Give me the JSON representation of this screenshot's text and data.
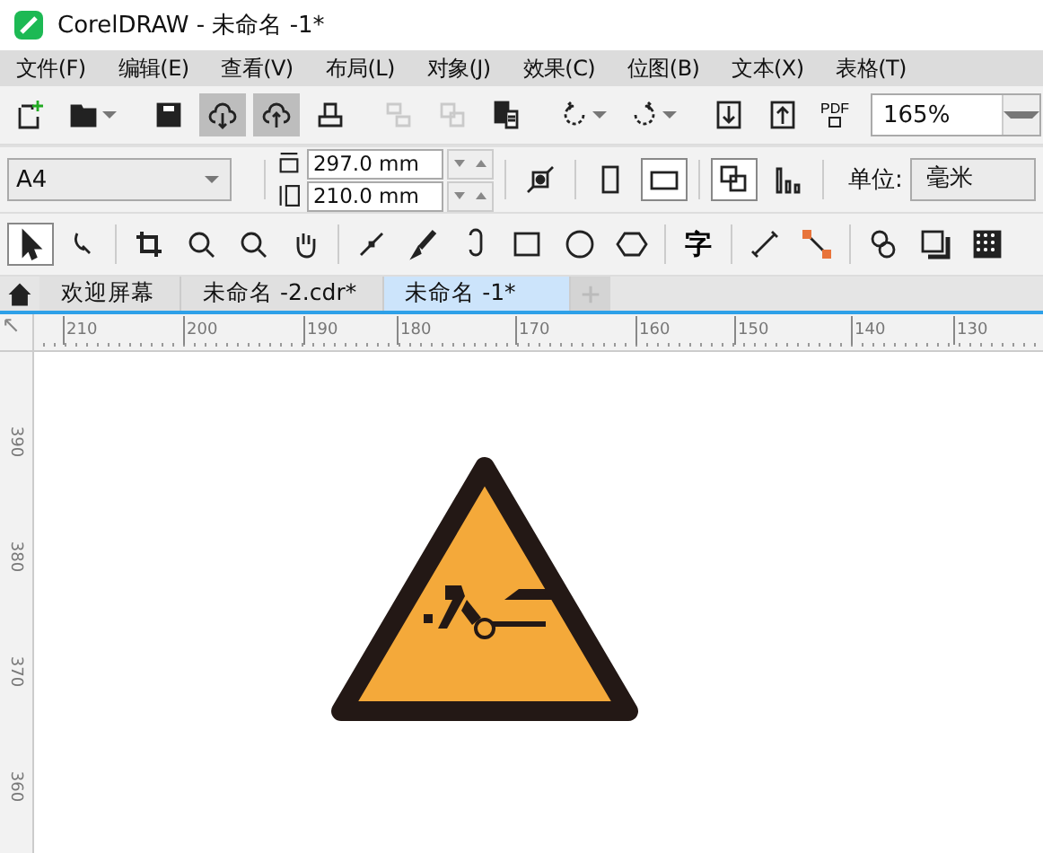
{
  "window": {
    "title": "CorelDRAW - 未命名 -1*"
  },
  "menu": [
    "文件(F)",
    "编辑(E)",
    "查看(V)",
    "布局(L)",
    "对象(J)",
    "效果(C)",
    "位图(B)",
    "文本(X)",
    "表格(T)"
  ],
  "toolbar": [
    {
      "kind": "new",
      "pressed": false,
      "disabled": false
    },
    {
      "kind": "open",
      "pressed": false,
      "disabled": false,
      "dropdown": true
    },
    {
      "kind": "sep"
    },
    {
      "kind": "save",
      "pressed": false,
      "disabled": false
    },
    {
      "kind": "cloud-down",
      "pressed": true,
      "disabled": false
    },
    {
      "kind": "cloud-up",
      "pressed": true,
      "disabled": false
    },
    {
      "kind": "print",
      "pressed": false,
      "disabled": false
    },
    {
      "kind": "sep"
    },
    {
      "kind": "cut",
      "pressed": false,
      "disabled": true
    },
    {
      "kind": "copy",
      "pressed": false,
      "disabled": true
    },
    {
      "kind": "paste",
      "pressed": false,
      "disabled": false
    },
    {
      "kind": "sep"
    },
    {
      "kind": "undo",
      "pressed": false,
      "disabled": false,
      "dropdown": true
    },
    {
      "kind": "redo",
      "pressed": false,
      "disabled": false,
      "dropdown": true
    },
    {
      "kind": "sep"
    },
    {
      "kind": "import",
      "pressed": false,
      "disabled": false
    },
    {
      "kind": "export",
      "pressed": false,
      "disabled": false
    },
    {
      "kind": "pdf",
      "pressed": false,
      "disabled": false,
      "label": "PDF"
    }
  ],
  "zoom": {
    "value": "165%"
  },
  "property_bar": {
    "page_size": "A4",
    "width": "297.0 mm",
    "height": "210.0 mm",
    "unit_label": "单位:",
    "unit": "毫米"
  },
  "tools": [
    {
      "kind": "pointer",
      "selected": true
    },
    {
      "kind": "shape",
      "selected": false
    },
    {
      "kind": "sep"
    },
    {
      "kind": "crop",
      "selected": false
    },
    {
      "kind": "zoom",
      "selected": false
    },
    {
      "kind": "zoom2",
      "selected": false
    },
    {
      "kind": "hand",
      "selected": false
    },
    {
      "kind": "sep"
    },
    {
      "kind": "line",
      "selected": false
    },
    {
      "kind": "brush",
      "selected": false
    },
    {
      "kind": "spiral",
      "selected": false
    },
    {
      "kind": "rect",
      "selected": false
    },
    {
      "kind": "ellipse",
      "selected": false
    },
    {
      "kind": "polygon",
      "selected": false
    },
    {
      "kind": "sep"
    },
    {
      "kind": "text",
      "selected": false,
      "label": "字"
    },
    {
      "kind": "sep"
    },
    {
      "kind": "dimension",
      "selected": false
    },
    {
      "kind": "connector",
      "selected": false
    },
    {
      "kind": "sep"
    },
    {
      "kind": "blend",
      "selected": false
    },
    {
      "kind": "shadow",
      "selected": false
    },
    {
      "kind": "transparency",
      "selected": false
    }
  ],
  "tabs": [
    {
      "label": "欢迎屏幕",
      "selected": false
    },
    {
      "label": "未命名 -2.cdr*",
      "selected": false
    },
    {
      "label": "未命名 -1*",
      "selected": true
    }
  ],
  "rulers": {
    "horizontal": [
      "210",
      "200",
      "190",
      "180",
      "170",
      "160",
      "150",
      "140",
      "130"
    ],
    "vertical": [
      "390",
      "380",
      "370",
      "360"
    ]
  }
}
